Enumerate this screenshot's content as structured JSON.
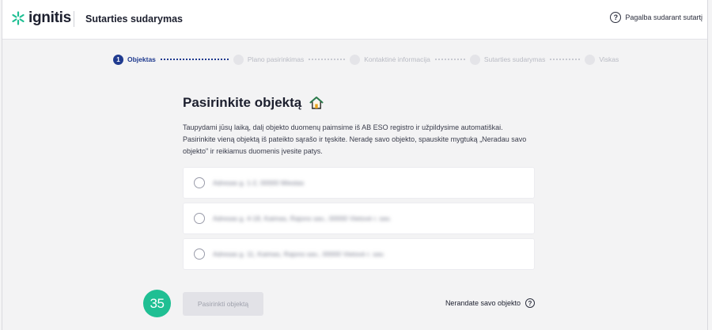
{
  "header": {
    "logo_text": "ignitis",
    "title": "Sutarties sudarymas",
    "help_text": "Pagalba sudarant sutartį"
  },
  "stepper": {
    "steps": [
      {
        "number": "1",
        "label": "Objektas",
        "state": "active"
      },
      {
        "number": "",
        "label": "Plano pasirinkimas",
        "state": "inactive"
      },
      {
        "number": "",
        "label": "Kontaktinė informacija",
        "state": "inactive"
      },
      {
        "number": "",
        "label": "Sutarties sudarymas",
        "state": "inactive"
      },
      {
        "number": "",
        "label": "Viskas",
        "state": "inactive"
      }
    ]
  },
  "main": {
    "title": "Pasirinkite objektą",
    "description": "Taupydami jūsų laiką, dalį objekto duomenų paimsime iš AB ESO registro ir užpildysime automatiškai. Pasirinkite vieną objektą iš pateikto sąrašo ir tęskite. Neradę savo objekto, spauskite mygtuką „Neradau savo objekto\" ir reikiamus duomenis įvesite patys.",
    "options": [
      {
        "text": "Adresas g. 1-2, 00000 Miestas"
      },
      {
        "text": "Adresas g. 4-18, Kaimas, Rajono sav., 00000 Vietovė r. sav."
      },
      {
        "text": "Adresas g. 11, Kaimas, Rajono sav., 00000 Vietovė r. sav."
      }
    ]
  },
  "actions": {
    "primary_label": "Pasirinkti objektą",
    "secondary_label": "Nerandate savo objekto"
  },
  "badge": {
    "number": "35"
  },
  "colors": {
    "accent": "#1f3a8f",
    "badge": "#1fbf93",
    "logo_mark": "#1fbf93",
    "house_roof": "#2a7a4b",
    "house_door": "#e9a31e"
  }
}
